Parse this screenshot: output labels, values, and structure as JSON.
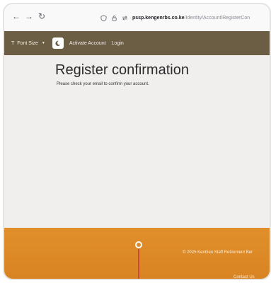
{
  "browser": {
    "back_icon": "arrow-left-icon",
    "forward_icon": "arrow-right-icon",
    "reload_icon": "reload-icon",
    "url_host": "pssp.kengenrbs.co.ke",
    "url_path": "/Identity/Account/RegisterCon"
  },
  "nav": {
    "font_size_label": "Font Size",
    "theme_icon": "moon-icon",
    "links": [
      "Activate Account",
      "Login"
    ],
    "bg_color": "#6b5e44"
  },
  "main": {
    "title": "Register confirmation",
    "message": "Please check your email to confirm your account."
  },
  "footer": {
    "copyright": "© 2025 KenGen Staff Retirement Ber",
    "contact": "Contact Us",
    "bg_color": "#dc8a27"
  }
}
